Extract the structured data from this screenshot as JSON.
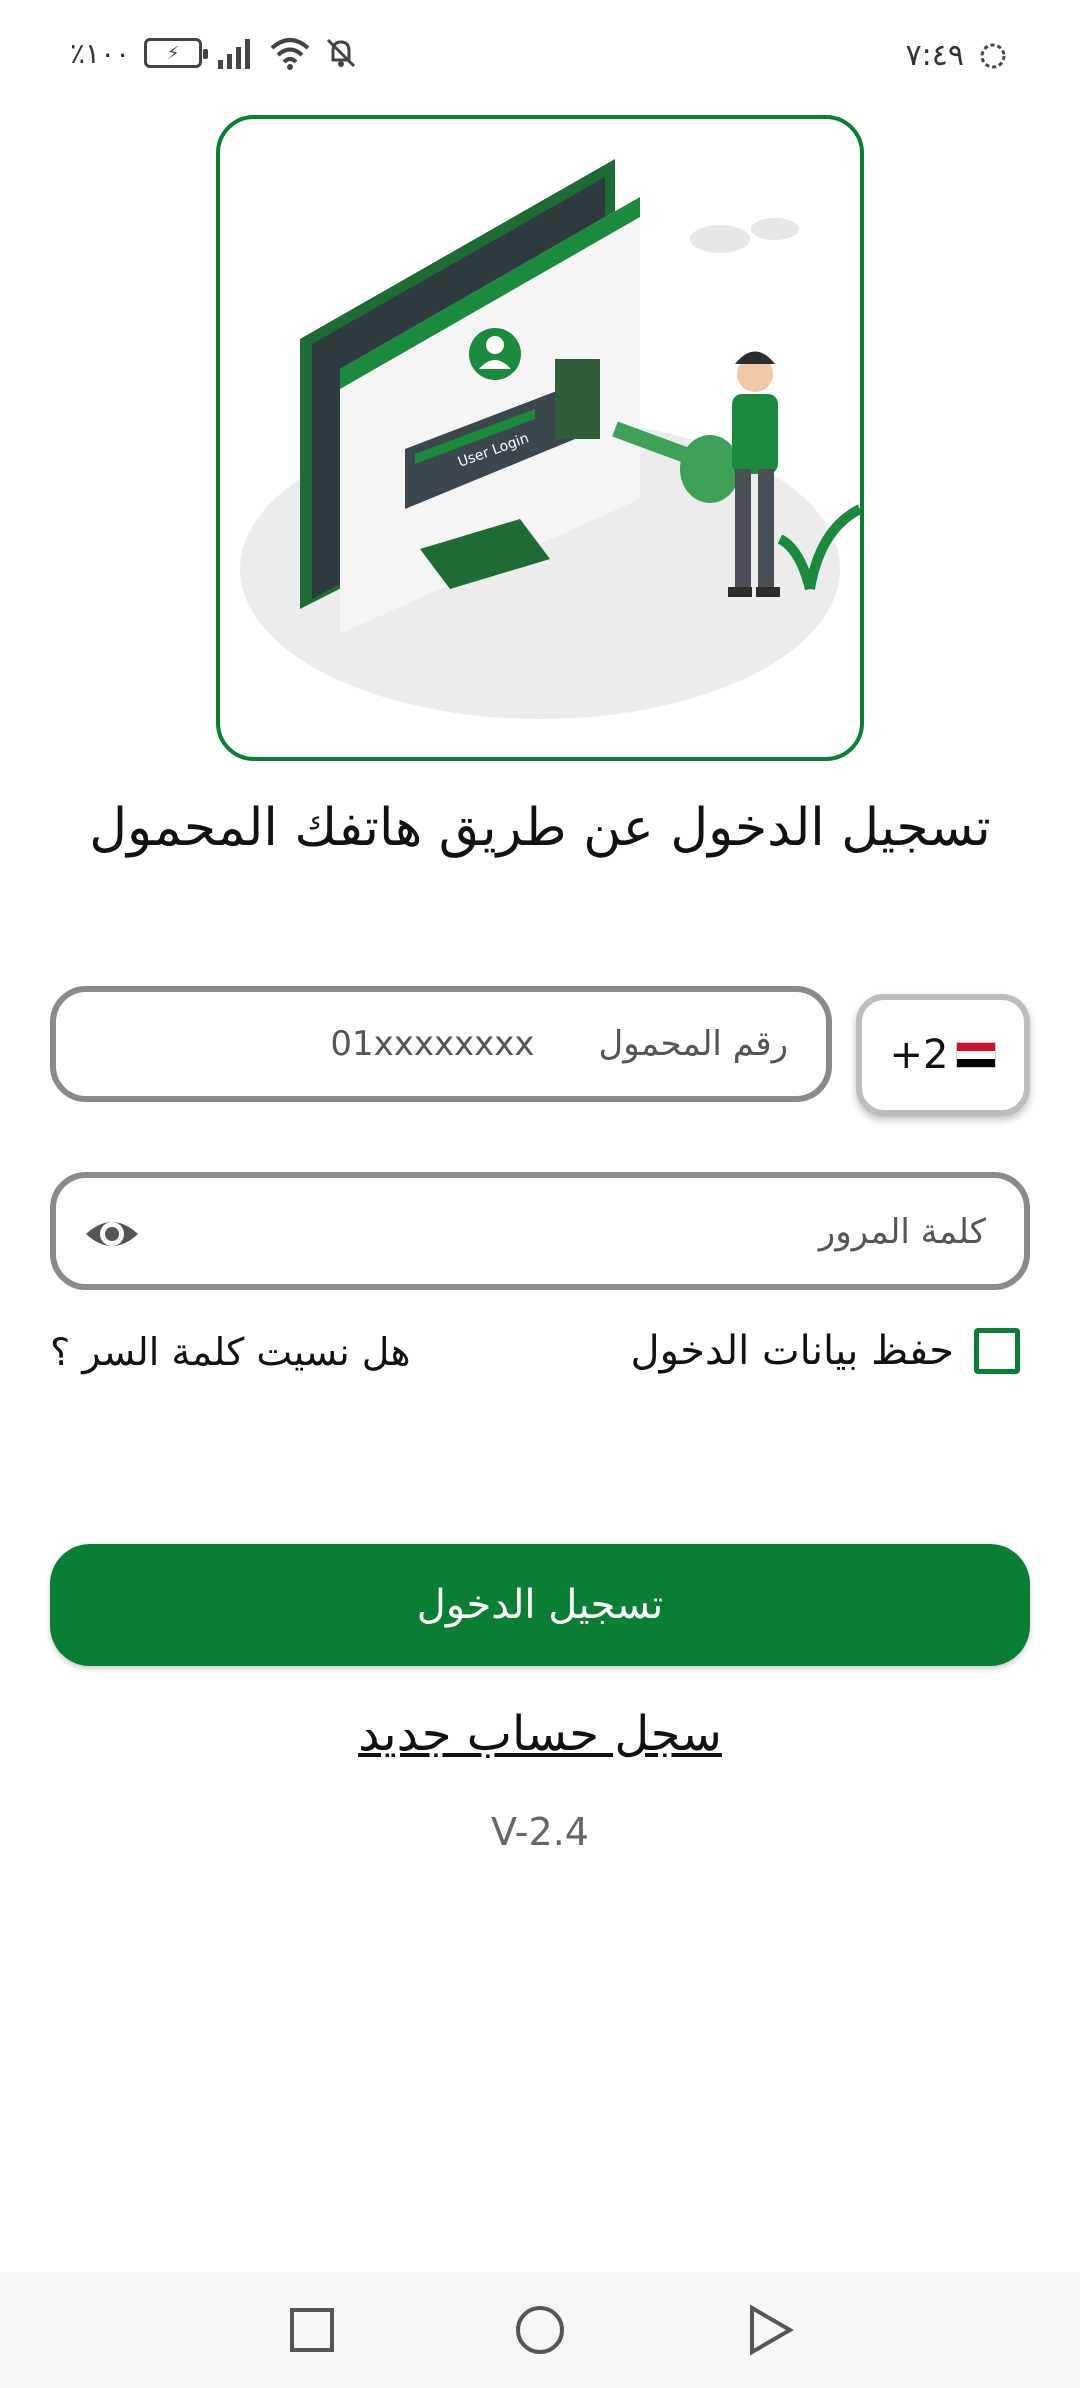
{
  "status_bar": {
    "time": "٧:٤٩",
    "battery_percent": "٪١٠٠",
    "icons": [
      "loading-icon",
      "battery-charging-icon",
      "signal-icon",
      "wifi-icon",
      "bell-off-icon"
    ]
  },
  "illustration": {
    "screen_caption": "User Login",
    "icon": "login-key-illustration"
  },
  "title": "تسجيل الدخول عن طريق هاتفك المحمول",
  "phone": {
    "label": "رقم المحمول",
    "placeholder": "01xxxxxxxx",
    "country_code": "+2",
    "flag": "egypt-flag-icon"
  },
  "password": {
    "placeholder": "كلمة المرور",
    "toggle_icon": "eye-icon"
  },
  "remember_me": {
    "label": "حفظ بيانات الدخول",
    "checked": false
  },
  "forgot_password": "هل نسيت كلمة السر ؟",
  "login_button": "تسجيل الدخول",
  "register_link": "سجل حساب جديد",
  "version": "V-2.4",
  "colors": {
    "brand_green": "#0a7e35",
    "border_gray": "#8a8a8a"
  },
  "nav_bar": {
    "buttons": [
      "recents-square-icon",
      "home-circle-icon",
      "back-triangle-icon"
    ]
  }
}
